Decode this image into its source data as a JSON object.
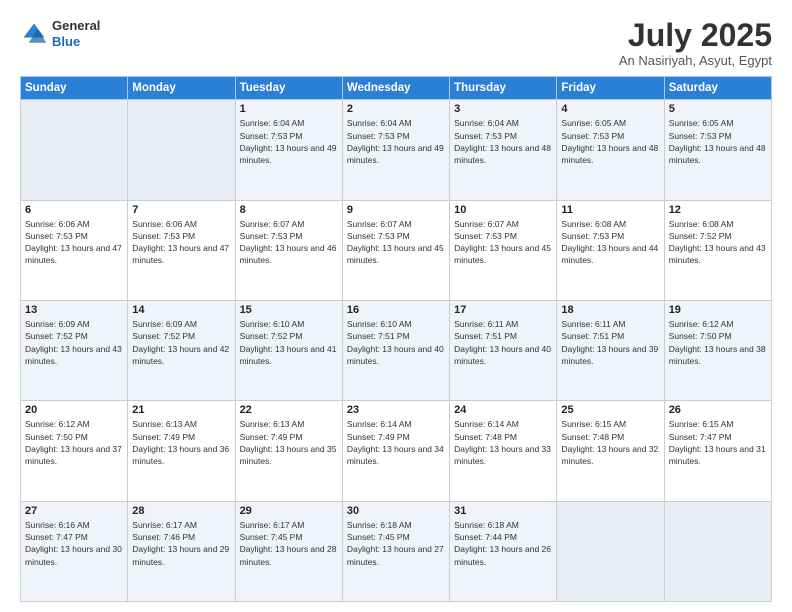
{
  "header": {
    "logo_line1": "General",
    "logo_line2": "Blue",
    "month": "July 2025",
    "location": "An Nasiriyah, Asyut, Egypt"
  },
  "weekdays": [
    "Sunday",
    "Monday",
    "Tuesday",
    "Wednesday",
    "Thursday",
    "Friday",
    "Saturday"
  ],
  "weeks": [
    [
      {
        "day": "",
        "empty": true
      },
      {
        "day": "",
        "empty": true
      },
      {
        "day": "1",
        "sunrise": "Sunrise: 6:04 AM",
        "sunset": "Sunset: 7:53 PM",
        "daylight": "Daylight: 13 hours and 49 minutes."
      },
      {
        "day": "2",
        "sunrise": "Sunrise: 6:04 AM",
        "sunset": "Sunset: 7:53 PM",
        "daylight": "Daylight: 13 hours and 49 minutes."
      },
      {
        "day": "3",
        "sunrise": "Sunrise: 6:04 AM",
        "sunset": "Sunset: 7:53 PM",
        "daylight": "Daylight: 13 hours and 48 minutes."
      },
      {
        "day": "4",
        "sunrise": "Sunrise: 6:05 AM",
        "sunset": "Sunset: 7:53 PM",
        "daylight": "Daylight: 13 hours and 48 minutes."
      },
      {
        "day": "5",
        "sunrise": "Sunrise: 6:05 AM",
        "sunset": "Sunset: 7:53 PM",
        "daylight": "Daylight: 13 hours and 48 minutes."
      }
    ],
    [
      {
        "day": "6",
        "sunrise": "Sunrise: 6:06 AM",
        "sunset": "Sunset: 7:53 PM",
        "daylight": "Daylight: 13 hours and 47 minutes."
      },
      {
        "day": "7",
        "sunrise": "Sunrise: 6:06 AM",
        "sunset": "Sunset: 7:53 PM",
        "daylight": "Daylight: 13 hours and 47 minutes."
      },
      {
        "day": "8",
        "sunrise": "Sunrise: 6:07 AM",
        "sunset": "Sunset: 7:53 PM",
        "daylight": "Daylight: 13 hours and 46 minutes."
      },
      {
        "day": "9",
        "sunrise": "Sunrise: 6:07 AM",
        "sunset": "Sunset: 7:53 PM",
        "daylight": "Daylight: 13 hours and 45 minutes."
      },
      {
        "day": "10",
        "sunrise": "Sunrise: 6:07 AM",
        "sunset": "Sunset: 7:53 PM",
        "daylight": "Daylight: 13 hours and 45 minutes."
      },
      {
        "day": "11",
        "sunrise": "Sunrise: 6:08 AM",
        "sunset": "Sunset: 7:53 PM",
        "daylight": "Daylight: 13 hours and 44 minutes."
      },
      {
        "day": "12",
        "sunrise": "Sunrise: 6:08 AM",
        "sunset": "Sunset: 7:52 PM",
        "daylight": "Daylight: 13 hours and 43 minutes."
      }
    ],
    [
      {
        "day": "13",
        "sunrise": "Sunrise: 6:09 AM",
        "sunset": "Sunset: 7:52 PM",
        "daylight": "Daylight: 13 hours and 43 minutes."
      },
      {
        "day": "14",
        "sunrise": "Sunrise: 6:09 AM",
        "sunset": "Sunset: 7:52 PM",
        "daylight": "Daylight: 13 hours and 42 minutes."
      },
      {
        "day": "15",
        "sunrise": "Sunrise: 6:10 AM",
        "sunset": "Sunset: 7:52 PM",
        "daylight": "Daylight: 13 hours and 41 minutes."
      },
      {
        "day": "16",
        "sunrise": "Sunrise: 6:10 AM",
        "sunset": "Sunset: 7:51 PM",
        "daylight": "Daylight: 13 hours and 40 minutes."
      },
      {
        "day": "17",
        "sunrise": "Sunrise: 6:11 AM",
        "sunset": "Sunset: 7:51 PM",
        "daylight": "Daylight: 13 hours and 40 minutes."
      },
      {
        "day": "18",
        "sunrise": "Sunrise: 6:11 AM",
        "sunset": "Sunset: 7:51 PM",
        "daylight": "Daylight: 13 hours and 39 minutes."
      },
      {
        "day": "19",
        "sunrise": "Sunrise: 6:12 AM",
        "sunset": "Sunset: 7:50 PM",
        "daylight": "Daylight: 13 hours and 38 minutes."
      }
    ],
    [
      {
        "day": "20",
        "sunrise": "Sunrise: 6:12 AM",
        "sunset": "Sunset: 7:50 PM",
        "daylight": "Daylight: 13 hours and 37 minutes."
      },
      {
        "day": "21",
        "sunrise": "Sunrise: 6:13 AM",
        "sunset": "Sunset: 7:49 PM",
        "daylight": "Daylight: 13 hours and 36 minutes."
      },
      {
        "day": "22",
        "sunrise": "Sunrise: 6:13 AM",
        "sunset": "Sunset: 7:49 PM",
        "daylight": "Daylight: 13 hours and 35 minutes."
      },
      {
        "day": "23",
        "sunrise": "Sunrise: 6:14 AM",
        "sunset": "Sunset: 7:49 PM",
        "daylight": "Daylight: 13 hours and 34 minutes."
      },
      {
        "day": "24",
        "sunrise": "Sunrise: 6:14 AM",
        "sunset": "Sunset: 7:48 PM",
        "daylight": "Daylight: 13 hours and 33 minutes."
      },
      {
        "day": "25",
        "sunrise": "Sunrise: 6:15 AM",
        "sunset": "Sunset: 7:48 PM",
        "daylight": "Daylight: 13 hours and 32 minutes."
      },
      {
        "day": "26",
        "sunrise": "Sunrise: 6:15 AM",
        "sunset": "Sunset: 7:47 PM",
        "daylight": "Daylight: 13 hours and 31 minutes."
      }
    ],
    [
      {
        "day": "27",
        "sunrise": "Sunrise: 6:16 AM",
        "sunset": "Sunset: 7:47 PM",
        "daylight": "Daylight: 13 hours and 30 minutes."
      },
      {
        "day": "28",
        "sunrise": "Sunrise: 6:17 AM",
        "sunset": "Sunset: 7:46 PM",
        "daylight": "Daylight: 13 hours and 29 minutes."
      },
      {
        "day": "29",
        "sunrise": "Sunrise: 6:17 AM",
        "sunset": "Sunset: 7:45 PM",
        "daylight": "Daylight: 13 hours and 28 minutes."
      },
      {
        "day": "30",
        "sunrise": "Sunrise: 6:18 AM",
        "sunset": "Sunset: 7:45 PM",
        "daylight": "Daylight: 13 hours and 27 minutes."
      },
      {
        "day": "31",
        "sunrise": "Sunrise: 6:18 AM",
        "sunset": "Sunset: 7:44 PM",
        "daylight": "Daylight: 13 hours and 26 minutes."
      },
      {
        "day": "",
        "empty": true
      },
      {
        "day": "",
        "empty": true
      }
    ]
  ]
}
